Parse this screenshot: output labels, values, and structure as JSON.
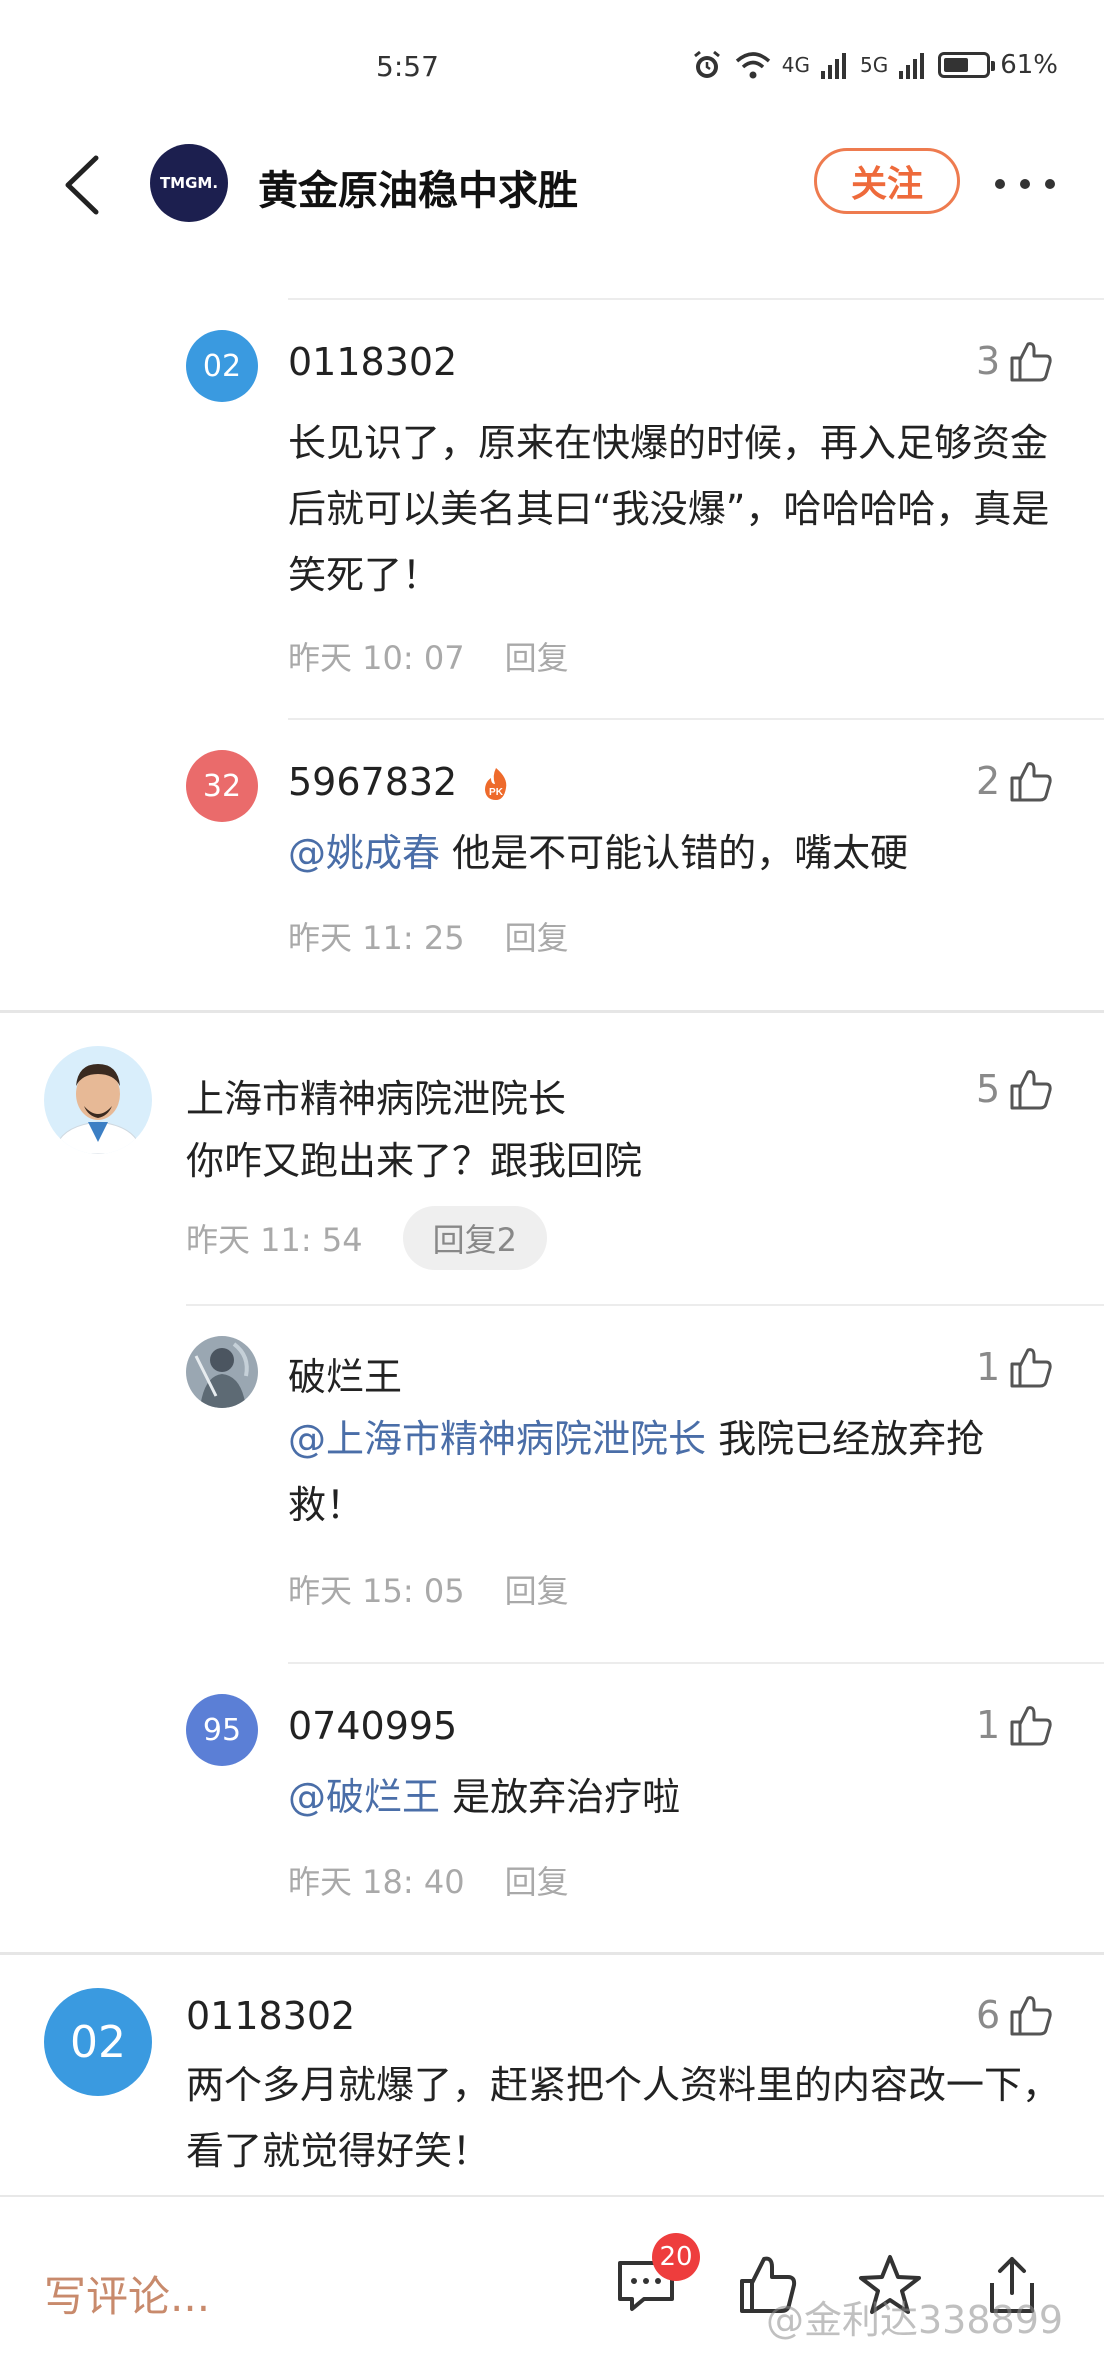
{
  "status_bar": {
    "time": "5:57",
    "network_1": "4G",
    "network_2": "5G",
    "battery_text": "61%",
    "battery_level": 0.61
  },
  "header": {
    "avatar_text": "TMGM.",
    "title": "黄金原油稳中求胜",
    "follow_label": "关注"
  },
  "comments": [
    {
      "avatar_text": "02",
      "avatar_color": "#3a9ae0",
      "username": "0118302",
      "likes": "3",
      "body": "长见识了，原来在快爆的时候，再入足够资金后就可以美名其曰“我没爆”，哈哈哈哈，真是笑死了！",
      "time": "昨天 10: 07",
      "reply_label": "回复"
    },
    {
      "avatar_text": "32",
      "avatar_color": "#ea6b6b",
      "username": "5967832",
      "badge": "PK",
      "likes": "2",
      "mention": "@姚成春",
      "body": " 他是不可能认错的，嘴太硬",
      "time": "昨天 11: 25",
      "reply_label": "回复"
    },
    {
      "username": "上海市精神病院泄院长",
      "likes": "5",
      "body": "你咋又跑出来了？跟我回院",
      "time": "昨天 11: 54",
      "reply_label": "回复2"
    },
    {
      "username": "破烂王",
      "likes": "1",
      "mention": "@上海市精神病院泄院长",
      "body": " 我院已经放弃抢救！",
      "time": "昨天 15: 05",
      "reply_label": "回复"
    },
    {
      "avatar_text": "95",
      "avatar_color": "#5b7fd6",
      "username": "0740995",
      "likes": "1",
      "mention": "@破烂王",
      "body": " 是放弃治疗啦",
      "time": "昨天 18: 40",
      "reply_label": "回复"
    },
    {
      "avatar_text": "02",
      "avatar_color": "#3a9ae0",
      "username": "0118302",
      "likes": "6",
      "body": "两个多月就爆了，赶紧把个人资料里的内容改一下，看了就觉得好笑！"
    }
  ],
  "bottom_bar": {
    "write_placeholder": "写评论...",
    "comment_count": "20",
    "watermark": "@金利达338899"
  }
}
